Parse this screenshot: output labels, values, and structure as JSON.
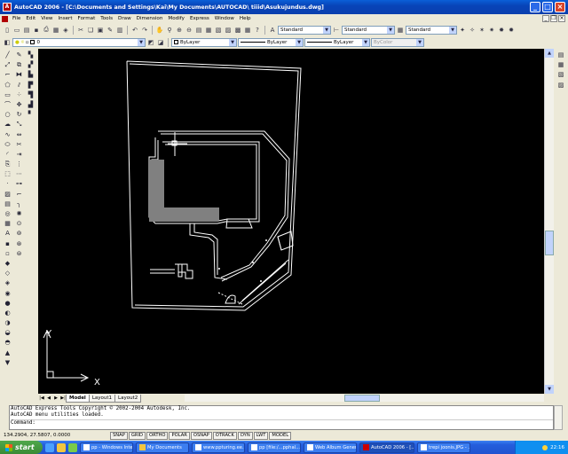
{
  "window": {
    "title": "AutoCAD 2006 - [C:\\Documents and Settings\\Kai\\My Documents\\AUTOCAD\\ tiiid\\Asukujundus.dwg]",
    "app_icon": "A"
  },
  "menu": [
    "File",
    "Edit",
    "View",
    "Insert",
    "Format",
    "Tools",
    "Draw",
    "Dimension",
    "Modify",
    "Express",
    "Window",
    "Help"
  ],
  "toolbar": {
    "text_style": "Standard",
    "dim_style": "Standard",
    "table_style": "Standard"
  },
  "properties": {
    "layer": "0",
    "color": "ByLayer",
    "linetype": "ByLayer",
    "lineweight": "ByLayer",
    "plotstyle": "ByColor"
  },
  "ucs": {
    "x_label": "X",
    "y_label": "Y"
  },
  "tabs": [
    "Model",
    "Layout1",
    "Layout2"
  ],
  "command": {
    "history": [
      "AutoCAD Express Tools Copyright © 2002-2004 Autodesk, Inc.",
      "AutoCAD menu utilities loaded."
    ],
    "prompt": "Command:"
  },
  "status": {
    "coords": "134.2904, 27.5807, 0.0000",
    "buttons": [
      "SNAP",
      "GRID",
      "ORTHO",
      "POLAR",
      "OSNAP",
      "OTRACK",
      "DYN",
      "LWT",
      "MODEL"
    ]
  },
  "taskbar": {
    "start": "start",
    "tasks": [
      "pp - Windows Inte...",
      "My Documents",
      "www.ppturing.ee...",
      "pp [file:/...pphal...",
      "Web Album Gener...",
      "AutoCAD 2006 - [...",
      "trepi joonis.JPG - ..."
    ],
    "clock": "22:16"
  },
  "colors": {
    "drawing_bg": "#000000",
    "line": "#ffffff",
    "hatch": "#808080",
    "titlebar": "#0a50c8"
  }
}
